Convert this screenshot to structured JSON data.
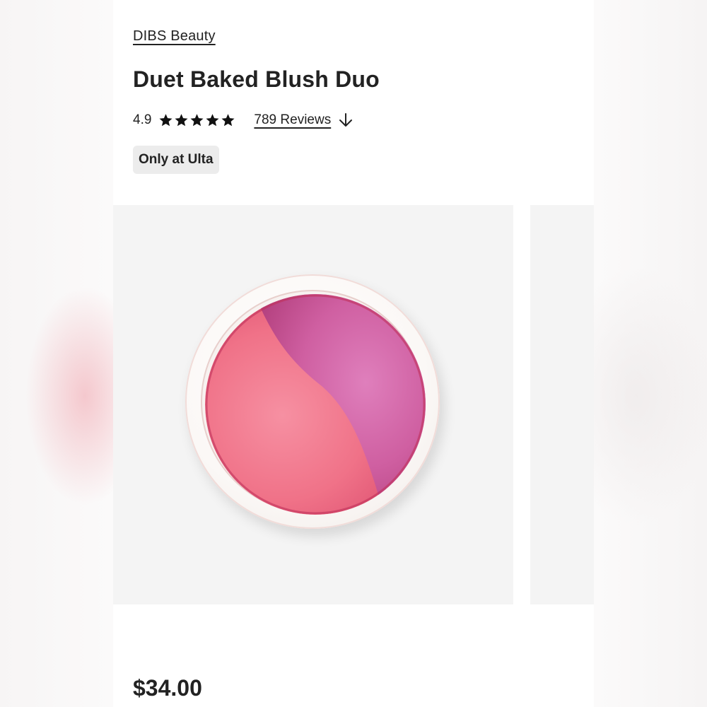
{
  "product": {
    "brand": "DIBS Beauty",
    "name": "Duet Baked Blush Duo",
    "rating": 4.9,
    "rating_label": "4.9",
    "star_count": 5,
    "reviews_label": "789 Reviews",
    "badge": "Only at Ulta",
    "price": "$34.00"
  },
  "gallery": {
    "image_alt": "Duet Baked Blush Duo compact"
  },
  "colors": {
    "text": "#222222",
    "badge_bg": "#ececec",
    "gallery_bg": "#f4f4f4",
    "blush_coral": "#f16d86",
    "blush_berry": "#c8559a"
  },
  "icons": {
    "star": "star-icon",
    "reviews_arrow": "arrow-down-icon"
  }
}
